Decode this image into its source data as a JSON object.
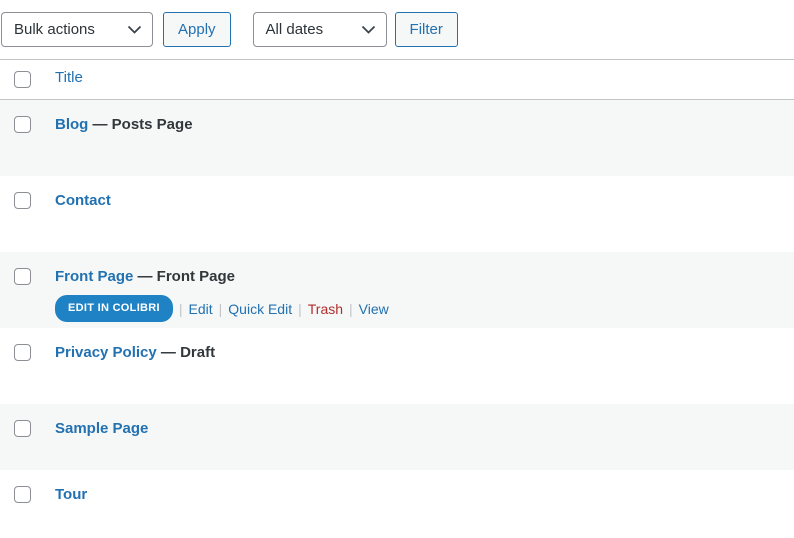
{
  "toolbar": {
    "bulk_actions_value": "Bulk actions",
    "apply_label": "Apply",
    "dates_value": "All dates",
    "filter_label": "Filter"
  },
  "table": {
    "header_title": "Title",
    "rows": [
      {
        "title": "Blog",
        "suffix": " — Posts Page"
      },
      {
        "title": "Contact",
        "suffix": ""
      },
      {
        "title": "Front Page",
        "suffix": " — Front Page"
      },
      {
        "title": "Privacy Policy",
        "suffix": " — Draft"
      },
      {
        "title": "Sample Page",
        "suffix": ""
      },
      {
        "title": "Tour",
        "suffix": ""
      }
    ],
    "row_actions": {
      "colibri": "EDIT IN COLIBRI",
      "edit": "Edit",
      "quick_edit": "Quick Edit",
      "trash": "Trash",
      "view": "View",
      "separator": "|"
    }
  },
  "icons": {
    "select_chevron": "chevron-down-icon"
  },
  "colors": {
    "link_blue": "#2271b1",
    "trash_red": "#b32d2e",
    "row_stripe": "#f6f7f7",
    "border_gray": "#c3c4c7",
    "input_border": "#8c8f94",
    "colibri_blue": "#1e82c4",
    "dark_text": "#32373c"
  }
}
